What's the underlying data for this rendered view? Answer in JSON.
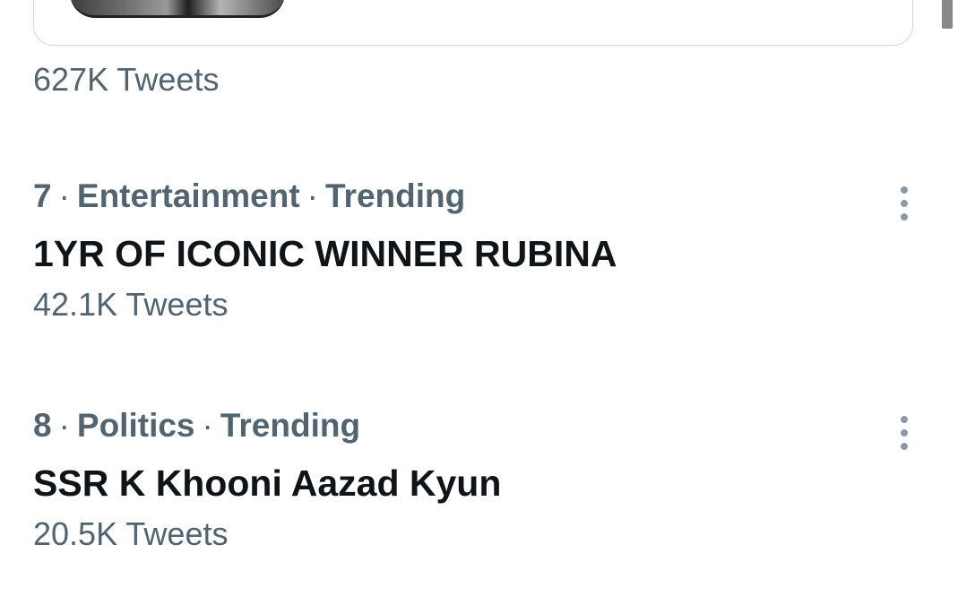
{
  "previous_trend": {
    "tweet_count": "627K Tweets"
  },
  "trends": [
    {
      "rank": "7",
      "category": "Entertainment",
      "status": "Trending",
      "title": "1YR OF ICONIC WINNER RUBINA",
      "tweet_count": "42.1K Tweets"
    },
    {
      "rank": "8",
      "category": "Politics",
      "status": "Trending",
      "title": "SSR K Khooni Aazad Kyun",
      "tweet_count": "20.5K Tweets"
    }
  ],
  "separator": "·",
  "icons": {
    "more": "more-horizontal-dots-icon"
  },
  "colors": {
    "secondary_text": "#536471",
    "primary_text": "#0f1419",
    "card_border": "#cfd9de",
    "more_icon": "#8b98a5"
  }
}
